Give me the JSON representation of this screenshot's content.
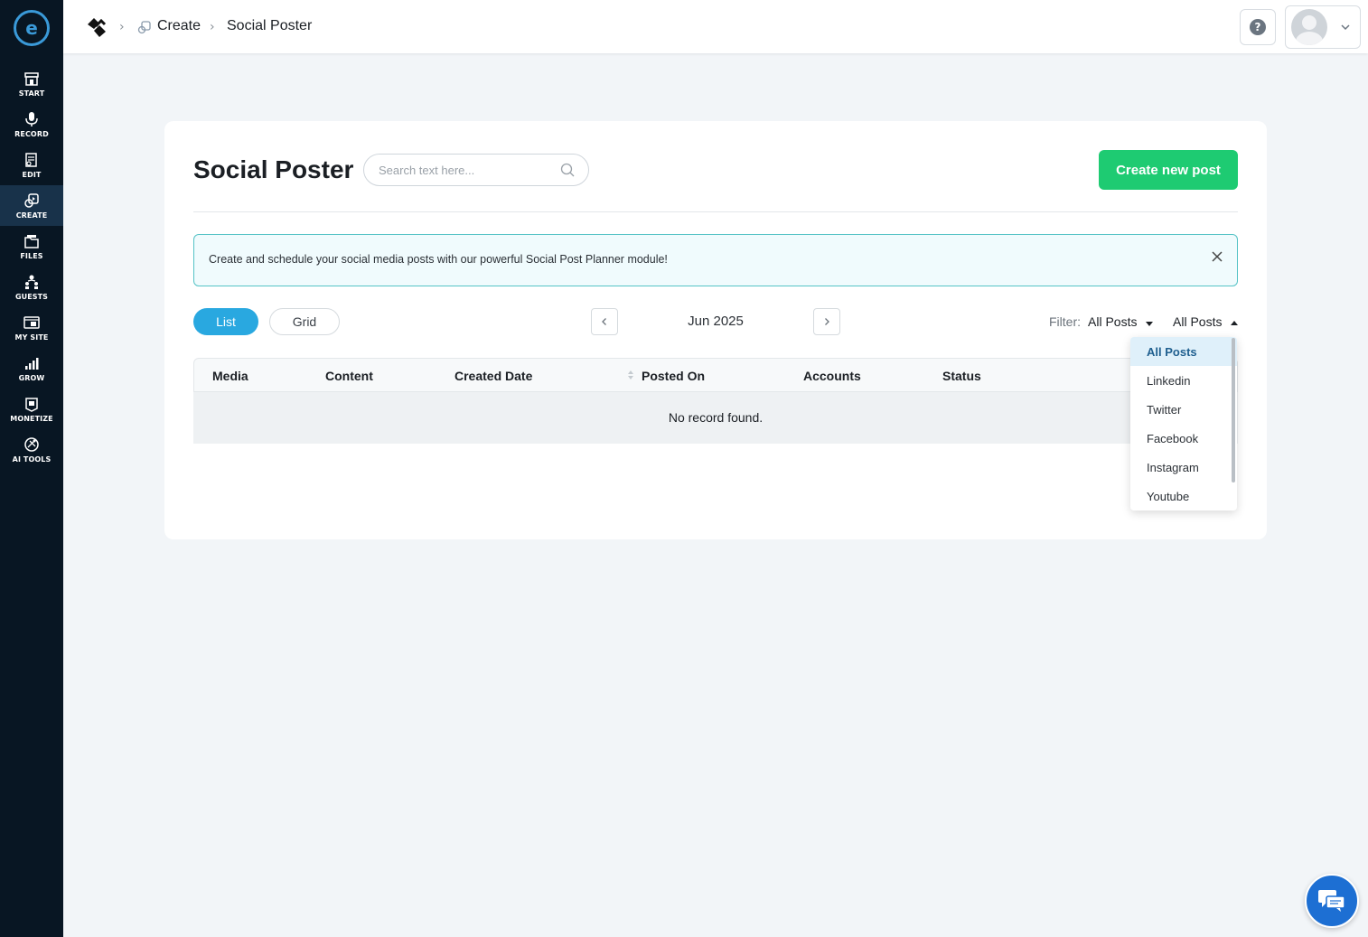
{
  "breadcrumb": {
    "items": [
      "Create",
      "Social Poster"
    ]
  },
  "sidebar": {
    "logo_text": "e",
    "items": [
      {
        "label": "START",
        "icon": "store-icon"
      },
      {
        "label": "RECORD",
        "icon": "microphone-icon"
      },
      {
        "label": "EDIT",
        "icon": "edit-icon"
      },
      {
        "label": "CREATE",
        "icon": "create-icon",
        "active": true
      },
      {
        "label": "FILES",
        "icon": "files-icon"
      },
      {
        "label": "GUESTS",
        "icon": "guests-icon"
      },
      {
        "label": "MY SITE",
        "icon": "site-icon"
      },
      {
        "label": "GROW",
        "icon": "chart-icon"
      },
      {
        "label": "MONETIZE",
        "icon": "monetize-icon"
      },
      {
        "label": "AI TOOLS",
        "icon": "ai-tools-icon"
      }
    ]
  },
  "header": {
    "help_symbol": "?"
  },
  "main": {
    "title": "Social Poster",
    "search_placeholder": "Search text here...",
    "create_button": "Create new post",
    "banner": "Create and schedule your social media posts with our powerful Social Post Planner module!",
    "views": {
      "list": "List",
      "grid": "Grid",
      "active": "list"
    },
    "month": "Jun 2025",
    "filter": {
      "label": "Filter:",
      "value": "All Posts",
      "second_value": "All Posts"
    },
    "table": {
      "columns": [
        "Media",
        "Content",
        "Created Date",
        "Posted On",
        "Accounts",
        "Status"
      ],
      "empty_message": "No record found."
    },
    "dropdown": {
      "options": [
        "All Posts",
        "Linkedin",
        "Twitter",
        "Facebook",
        "Instagram",
        "Youtube"
      ],
      "selected": "All Posts"
    }
  },
  "colors": {
    "sidebar_bg": "#081623",
    "accent_green": "#1ecb72",
    "accent_blue": "#29a8e0",
    "banner_border": "#55c3c6",
    "chat_blue": "#1d6fd3"
  }
}
